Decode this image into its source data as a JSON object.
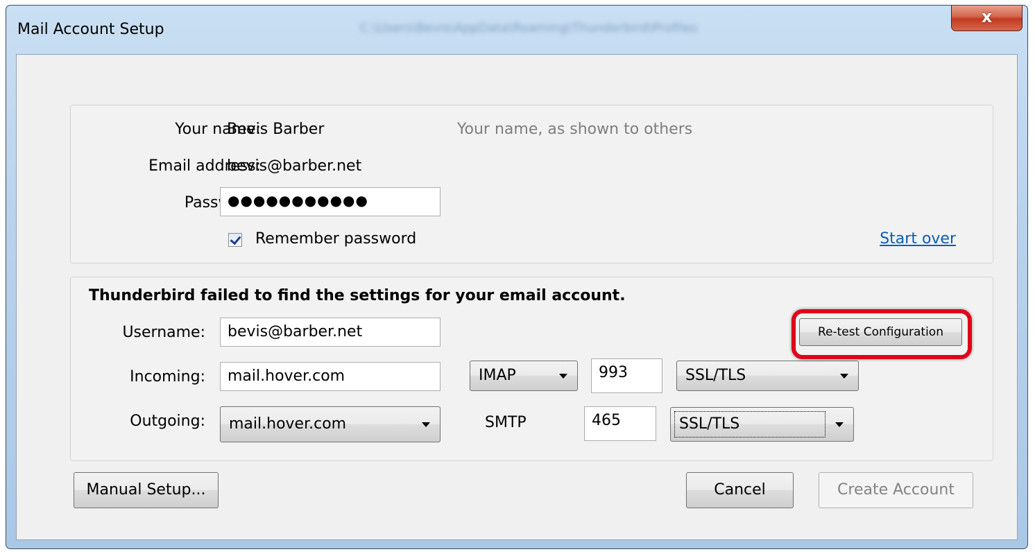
{
  "window": {
    "title": "Mail Account Setup",
    "titlebar_path": "C:\\Users\\Bevis\\AppData\\Roaming\\Thunderbird\\Profiles",
    "close_glyph": "x"
  },
  "identity": {
    "name_label": "Your name:",
    "name_value": "Bevis Barber",
    "name_hint": "Your name, as shown to others",
    "email_label": "Email address:",
    "email_value": "bevis@barber.net",
    "password_label": "Password:",
    "password_value": "●●●●●●●●●●●",
    "remember_label": "Remember password",
    "remember_checked": true,
    "start_over": "Start over"
  },
  "settings": {
    "status": "Thunderbird failed to find the settings for your email account.",
    "retest_button": "Re-test Configuration",
    "username_label": "Username:",
    "username_value": "bevis@barber.net",
    "incoming_label": "Incoming:",
    "incoming_server": "mail.hover.com",
    "incoming_protocol": "IMAP",
    "incoming_port": "993",
    "incoming_security": "SSL/TLS",
    "outgoing_label": "Outgoing:",
    "outgoing_server": "mail.hover.com",
    "outgoing_protocol": "SMTP",
    "outgoing_port": "465",
    "outgoing_security": "SSL/TLS"
  },
  "buttons": {
    "manual_setup": "Manual Setup...",
    "cancel": "Cancel",
    "create_account": "Create Account"
  },
  "colors": {
    "highlight": "#e0001b",
    "link": "#0a5cb8",
    "hint_text": "#7d7d7d"
  }
}
